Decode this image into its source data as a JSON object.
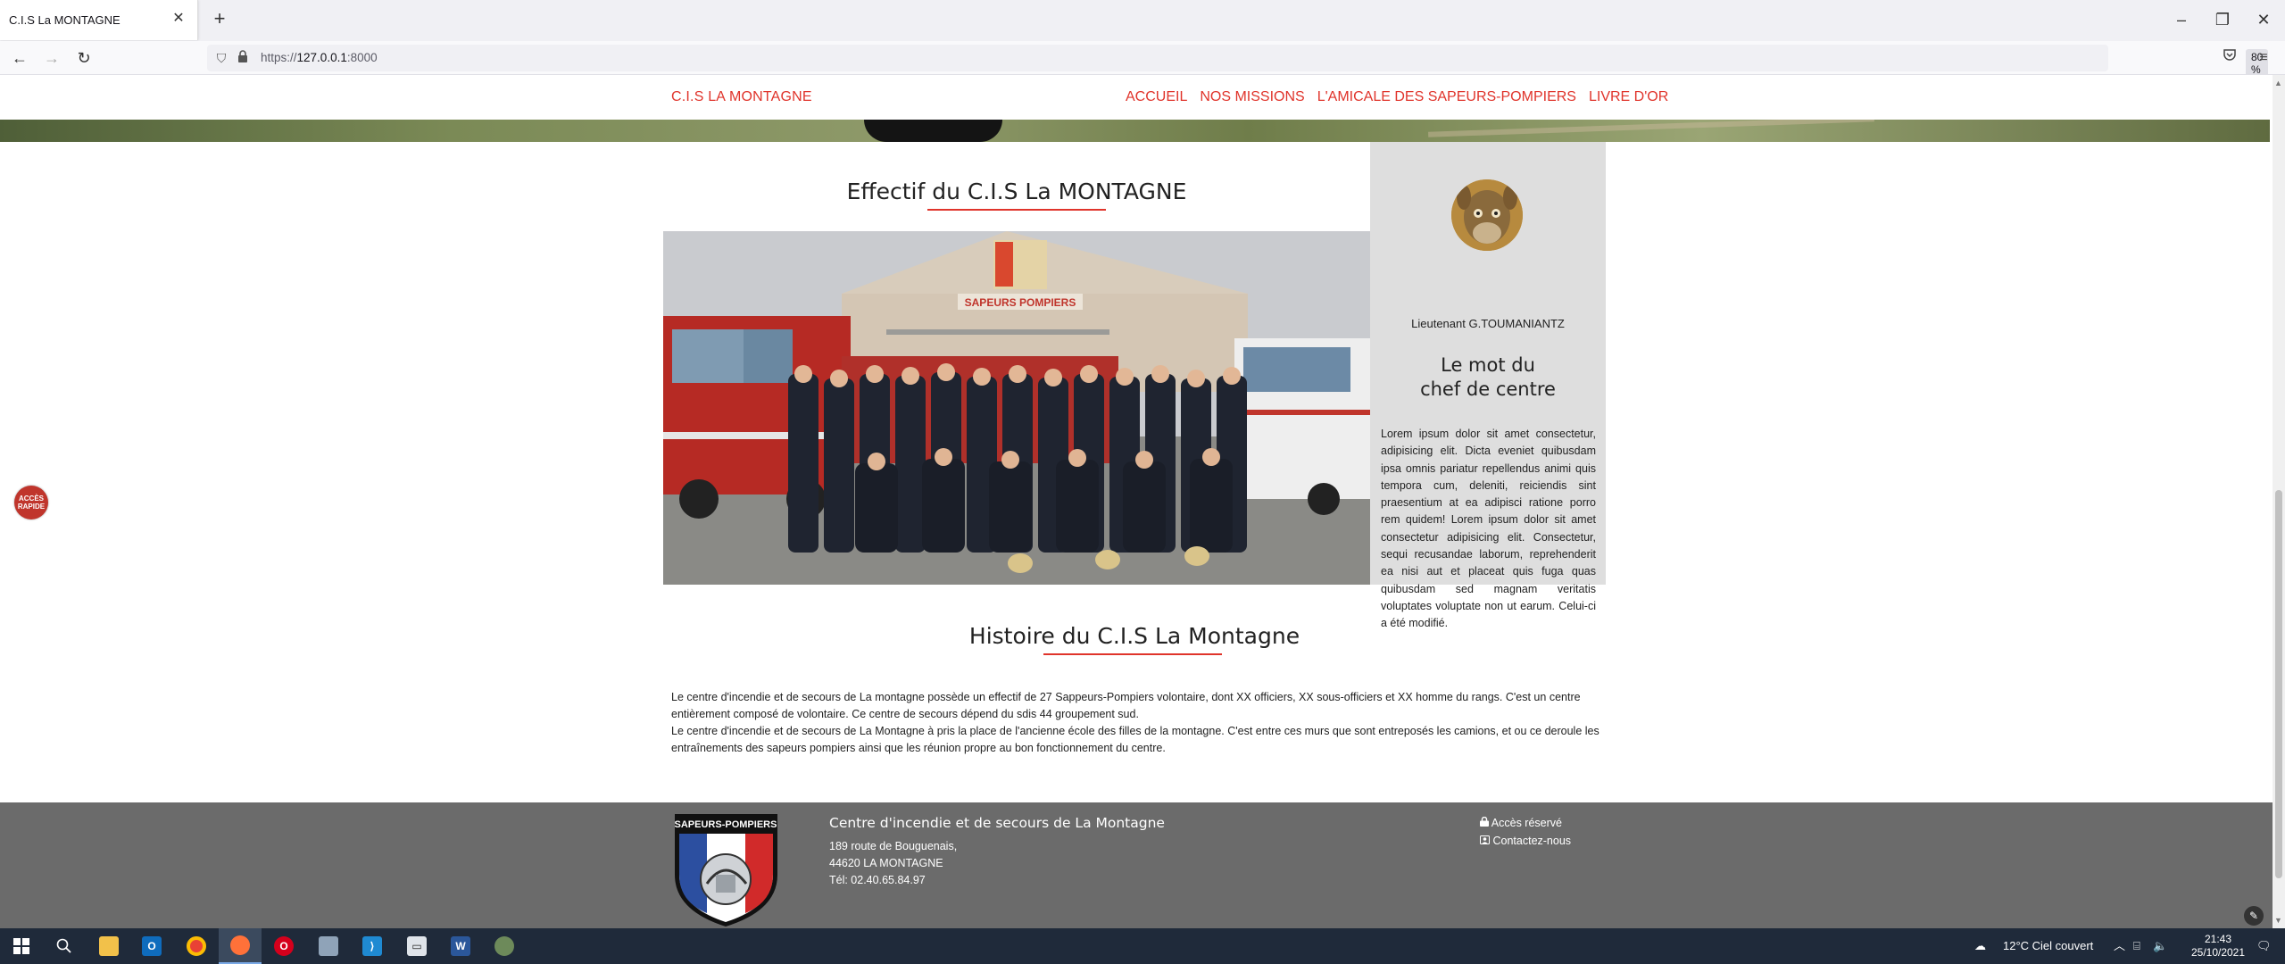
{
  "browser": {
    "tab_title": "C.I.S La MONTAGNE",
    "tab_close": "✕",
    "new_tab": "+",
    "url_prefix": "https://",
    "url_host": "127.0.0.1",
    "url_port": ":8000",
    "zoom": "80 %"
  },
  "site": {
    "brand": "C.I.S LA MONTAGNE",
    "menu": [
      "ACCUEIL",
      "NOS MISSIONS",
      "L'AMICALE DES SAPEURS-POMPIERS",
      "LIVRE D'OR"
    ],
    "accent_color": "#e0342b"
  },
  "effectif": {
    "title": "Effectif du C.I.S La MONTAGNE",
    "photo_sign": "SAPEURS POMPIERS"
  },
  "chief": {
    "name": "Lieutenant G.TOUMANIANTZ",
    "title_line1": "Le mot du",
    "title_line2": "chef de centre",
    "text": "Lorem ipsum dolor sit amet consectetur, adipisicing elit. Dicta eveniet quibusdam ipsa omnis pariatur repellendus animi quis tempora cum, deleniti, reiciendis sint praesentium at ea adipisci ratione porro rem quidem! Lorem ipsum dolor sit amet consectetur adipisicing elit. Consectetur, sequi recusandae laborum, reprehenderit ea nisi aut et placeat quis fuga quas quibusdam sed magnam veritatis voluptates voluptate non ut earum. Celui-ci a été modifié."
  },
  "histoire": {
    "title": "Histoire du C.I.S La Montagne",
    "paragraph1": "Le centre d'incendie et de secours de La montagne possède un effectif de 27 Sappeurs-Pompiers volontaire, dont XX officiers, XX sous-officiers et XX homme du rangs. C'est un centre entièrement composé de volontaire. Ce centre de secours dépend du sdis 44 groupement sud.",
    "paragraph2": "Le centre d'incendie et de secours de La Montagne à pris la place de l'ancienne école des filles de la montagne. C'est entre ces murs que sont entreposés les camions, et ou ce deroule les entraînements des sapeurs pompiers ainsi que les réunion propre au bon fonctionnement du centre."
  },
  "footer": {
    "logo_text": "SAPEURS-POMPIERS",
    "title": "Centre d'incendie et de secours de La Montagne",
    "address_line1": "189 route de Bouguenais,",
    "address_line2": "44620 LA MONTAGNE",
    "phone": "Tél: 02.40.65.84.97",
    "link_reserved": "Accès réservé",
    "link_contact": "Contactez-nous"
  },
  "quick_access": {
    "line1": "ACCÈS",
    "line2": "RAPIDE"
  },
  "taskbar": {
    "weather": "12°C  Ciel couvert",
    "time": "21:43",
    "date": "25/10/2021"
  }
}
